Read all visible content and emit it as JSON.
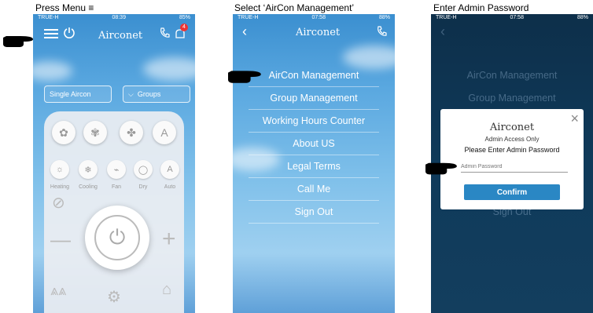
{
  "captions": [
    "Press Menu ≡",
    "Select ‘AirCon Management’",
    "Enter Admin Password"
  ],
  "phone1": {
    "status": {
      "carrier": "TRUE-H",
      "time": "08:39",
      "battery": "85%"
    },
    "logo": "Airconet",
    "notification_count": "4",
    "single_select": "Single Aircon",
    "groups_select": "Groups",
    "fan_buttons": [
      "fan-low-icon",
      "fan-medium-icon",
      "fan-high-icon",
      "A"
    ],
    "mode_labels": [
      "Heating",
      "Cooling",
      "Fan",
      "Dry",
      "Auto"
    ],
    "mode_glyphs": [
      "☼",
      "❄",
      "⌁",
      "◯",
      "A"
    ]
  },
  "phone2": {
    "status": {
      "carrier": "TRUE-H",
      "time": "07:58",
      "battery": "88%"
    },
    "logo": "Airconet",
    "menu": [
      "AirCon Management",
      "Group Management",
      "Working Hours Counter",
      "About US",
      "Legal Terms",
      "Call Me",
      "Sign Out"
    ]
  },
  "phone3": {
    "status": {
      "carrier": "TRUE-H",
      "time": "07:58",
      "battery": "88%"
    },
    "dim_menu": [
      "AirCon Management",
      "Group Management",
      "Sign Out"
    ],
    "dialog": {
      "logo": "Airconet",
      "subtitle": "Admin Access Only",
      "prompt": "Please Enter Admin Password",
      "placeholder": "Admin Password",
      "confirm_label": "Confirm"
    }
  }
}
